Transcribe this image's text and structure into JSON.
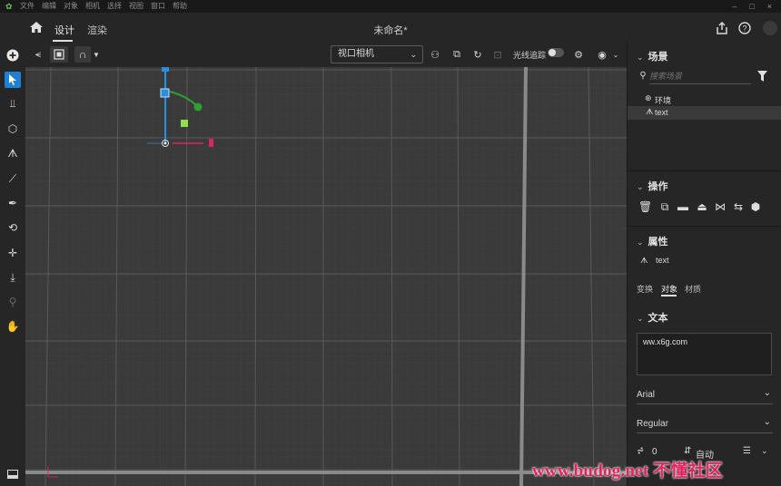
{
  "menu": {
    "items": [
      "文件",
      "编辑",
      "对象",
      "相机",
      "选择",
      "视图",
      "窗口",
      "帮助"
    ],
    "window_controls": [
      "–",
      "□",
      "×"
    ]
  },
  "header": {
    "tabs": [
      {
        "label": "设计",
        "active": true
      },
      {
        "label": "渲染",
        "active": false
      }
    ],
    "document_title": "未命名*"
  },
  "viewport_toolbar": {
    "camera_select": {
      "value": "视口相机"
    },
    "raytrace_label": "光线追踪",
    "raytrace_on": false
  },
  "scene": {
    "title": "场景",
    "search_placeholder": "搜索场景",
    "items": [
      {
        "label": "环境",
        "icon": "globe-icon",
        "selected": false
      },
      {
        "label": "text",
        "icon": "text-object-icon",
        "selected": true
      }
    ]
  },
  "operations": {
    "title": "操作"
  },
  "properties": {
    "title": "属性",
    "object_name": "text",
    "tabs": [
      {
        "label": "变换",
        "active": false
      },
      {
        "label": "对象",
        "active": true
      },
      {
        "label": "材质",
        "active": false
      }
    ],
    "text_section_title": "文本",
    "text_value": "ww.x6g.com",
    "font_family": "Arial",
    "font_style": "Regular",
    "tracking_value": "0",
    "auto_label": "自动"
  },
  "watermark": {
    "text": "www.budog.net 不懂社区"
  },
  "colors": {
    "accent": "#1d82d6",
    "gizmo_x": "#e0245e",
    "gizmo_y": "#2fa02f",
    "gizmo_z": "#2d8ee0",
    "watermark": "#e0245e"
  }
}
